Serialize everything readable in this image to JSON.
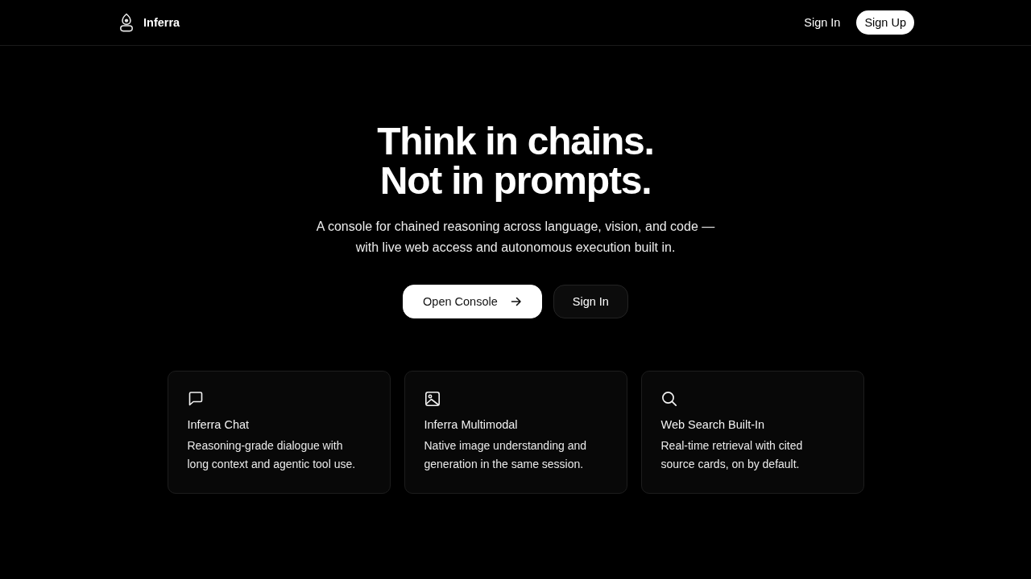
{
  "header": {
    "brand": "Inferra",
    "nav": [
      {
        "label": "Sign In",
        "kind": "link"
      },
      {
        "label": "Sign Up",
        "kind": "pill"
      }
    ]
  },
  "hero": {
    "title": "Think in chains. Not in prompts.",
    "subtitle": "A console for chained reasoning across language, vision, and code — with live web access and autonomous execution built in.",
    "buttons": [
      {
        "label": "Open Console",
        "kind": "primary"
      },
      {
        "label": "Sign In",
        "kind": "secondary"
      }
    ]
  },
  "features": [
    {
      "title": "Inferra Chat",
      "description": "Reasoning-grade dialogue with long context and agentic tool use."
    },
    {
      "title": "Inferra Multimodal",
      "description": "Native image understanding and generation in the same session."
    },
    {
      "title": "Web Search Built-In",
      "description": "Real-time retrieval with cited source cards, on by default."
    }
  ]
}
